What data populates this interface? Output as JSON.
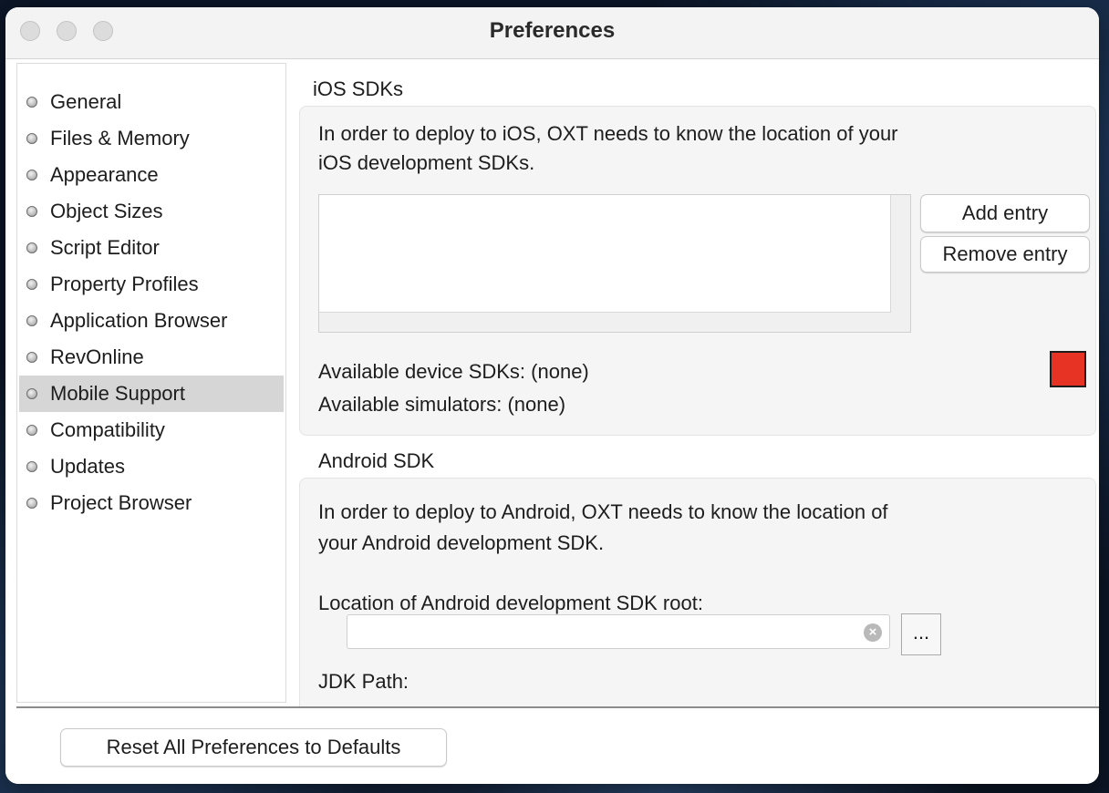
{
  "window": {
    "title": "Preferences"
  },
  "sidebar": {
    "items": [
      {
        "label": "General"
      },
      {
        "label": "Files & Memory"
      },
      {
        "label": "Appearance"
      },
      {
        "label": "Object Sizes"
      },
      {
        "label": "Script Editor"
      },
      {
        "label": "Property Profiles"
      },
      {
        "label": "Application Browser"
      },
      {
        "label": "RevOnline"
      },
      {
        "label": "Mobile Support",
        "selected": true
      },
      {
        "label": "Compatibility"
      },
      {
        "label": "Updates"
      },
      {
        "label": "Project Browser"
      }
    ]
  },
  "ios": {
    "section_title": "iOS SDKs",
    "description_line1": "In order to deploy to iOS, OXT needs to know the location of your",
    "description_line2": "iOS development SDKs.",
    "add_entry_label": "Add entry",
    "remove_entry_label": "Remove entry",
    "available_device_sdks": "Available device SDKs: (none)",
    "available_simulators": "Available simulators: (none)",
    "status_color": "#e63323"
  },
  "android": {
    "section_title": "Android SDK",
    "description_line1": "In order to deploy to Android, OXT needs to know the location of",
    "description_line2": "your Android development SDK.",
    "sdk_root_label": "Location of Android development SDK root:",
    "sdk_root_value": "",
    "browse_label": "...",
    "jdk_path_label": "JDK Path:"
  },
  "footer": {
    "reset_label": "Reset All Preferences to Defaults"
  }
}
